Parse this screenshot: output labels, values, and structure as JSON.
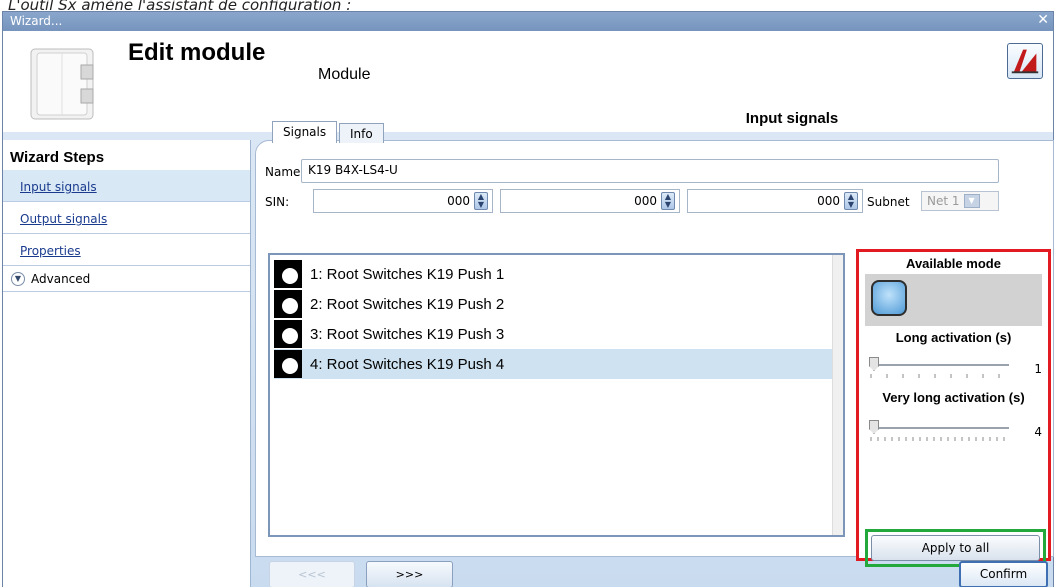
{
  "caption": "L'outil Sx amène l'assistant de configuration :",
  "window": {
    "title": "Wizard...",
    "close_glyph": "✕"
  },
  "header": {
    "title": "Edit module",
    "subtitle": "Module",
    "tab_label": "Input signals"
  },
  "wizard_steps": {
    "title": "Wizard Steps",
    "items": [
      {
        "label": "Input signals",
        "active": true
      },
      {
        "label": "Output signals",
        "active": false
      },
      {
        "label": "Properties",
        "active": false
      }
    ],
    "advanced_label": "Advanced"
  },
  "form": {
    "name_label": "Name",
    "name_value": "K19 B4X-LS4-U",
    "sin_label": "SIN:",
    "sin_values": [
      "000",
      "000",
      "000"
    ],
    "subnet_label": "Subnet",
    "subnet_value": "Net 1"
  },
  "tabs": [
    {
      "label": "Signals",
      "active": true
    },
    {
      "label": "Info",
      "active": false
    }
  ],
  "signals": [
    {
      "label": "1: Root Switches K19 Push 1",
      "selected": false
    },
    {
      "label": "2: Root Switches K19 Push 2",
      "selected": false
    },
    {
      "label": "3: Root Switches K19 Push 3",
      "selected": false
    },
    {
      "label": "4: Root Switches K19 Push 4",
      "selected": true
    }
  ],
  "mode_panel": {
    "title": "Available mode",
    "long_label": "Long activation (s)",
    "long_value": "1",
    "long_level": 0,
    "very_long_label": "Very long activation (s)",
    "very_long_value": "4",
    "very_long_level": 0,
    "apply_label": "Apply to all"
  },
  "nav": {
    "prev_label": "<<<",
    "next_label": ">>>",
    "confirm_label": "Confirm"
  },
  "colors": {
    "highlight_red": "#e21b23",
    "highlight_green": "#22a83b",
    "selected_row": "#cfe2f1"
  }
}
